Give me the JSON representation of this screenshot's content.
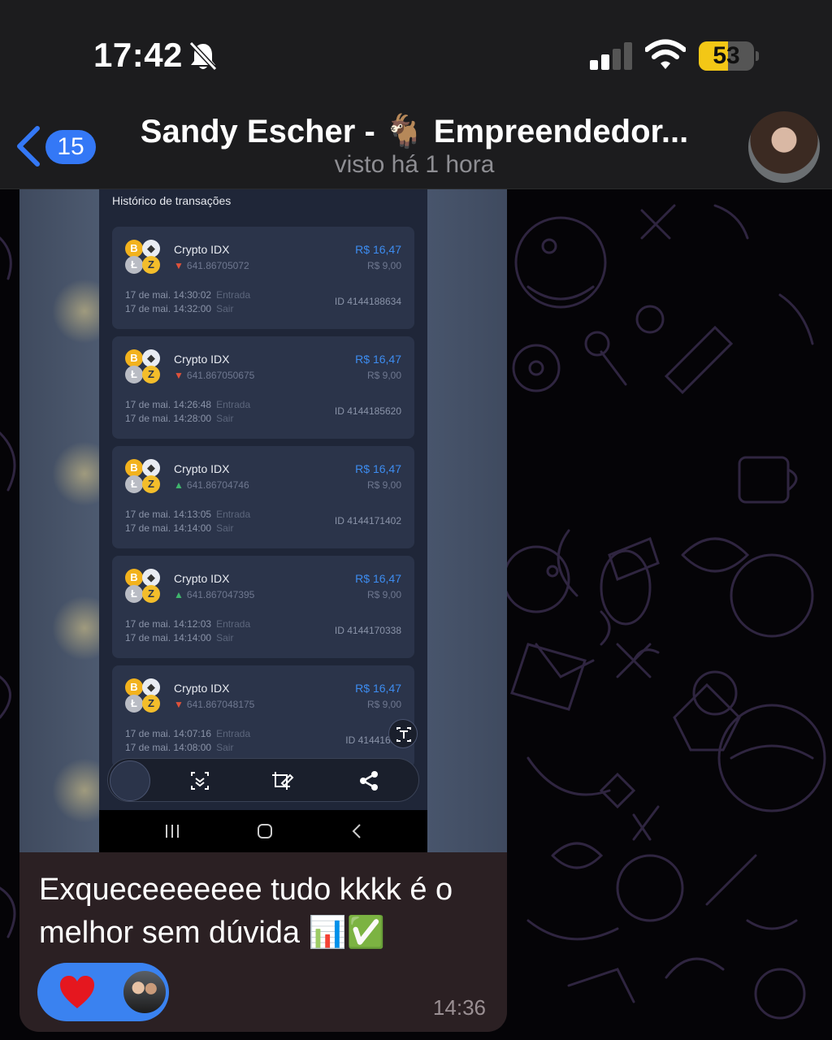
{
  "status_bar": {
    "time": "17:42",
    "battery_level": "53",
    "battery_fraction": 0.53,
    "icons": [
      "bell-slash-icon",
      "signal-icon",
      "wifi-icon",
      "battery-icon"
    ]
  },
  "header": {
    "unread_count": "15",
    "title": "Sandy Escher - 🐐 Empreendedor...",
    "subtitle": "visto há 1 hora"
  },
  "screenshot": {
    "title": "Histórico de transações",
    "transactions": [
      {
        "name": "Crypto IDX",
        "direction": "down",
        "price": "641.86705072",
        "amount": "R$ 16,47",
        "stake": "R$ 9,00",
        "open_date": "17 de mai.",
        "open_time": "14:30:02",
        "open_label": "Entrada",
        "close_date": "17 de mai.",
        "close_time": "14:32:00",
        "close_label": "Sair",
        "id": "ID 4144188634"
      },
      {
        "name": "Crypto IDX",
        "direction": "down",
        "price": "641.867050675",
        "amount": "R$ 16,47",
        "stake": "R$ 9,00",
        "open_date": "17 de mai.",
        "open_time": "14:26:48",
        "open_label": "Entrada",
        "close_date": "17 de mai.",
        "close_time": "14:28:00",
        "close_label": "Sair",
        "id": "ID 4144185620"
      },
      {
        "name": "Crypto IDX",
        "direction": "up",
        "price": "641.86704746",
        "amount": "R$ 16,47",
        "stake": "R$ 9,00",
        "open_date": "17 de mai.",
        "open_time": "14:13:05",
        "open_label": "Entrada",
        "close_date": "17 de mai.",
        "close_time": "14:14:00",
        "close_label": "Sair",
        "id": "ID 4144171402"
      },
      {
        "name": "Crypto IDX",
        "direction": "up",
        "price": "641.867047395",
        "amount": "R$ 16,47",
        "stake": "R$ 9,00",
        "open_date": "17 de mai.",
        "open_time": "14:12:03",
        "open_label": "Entrada",
        "close_date": "17 de mai.",
        "close_time": "14:14:00",
        "close_label": "Sair",
        "id": "ID 4144170338"
      },
      {
        "name": "Crypto IDX",
        "direction": "down",
        "price": "641.867048175",
        "amount": "R$ 16,47",
        "stake": "R$ 9,00",
        "open_date": "17 de mai.",
        "open_time": "14:07:16",
        "open_label": "Entrada",
        "close_date": "17 de mai.",
        "close_time": "14:08:00",
        "close_label": "Sair",
        "id": "ID 41441655"
      }
    ]
  },
  "message": {
    "text": "Exqueceeeeeee tudo kkkk é o melhor sem dúvida 📊✅",
    "time": "14:36",
    "reaction": "heart"
  },
  "colors": {
    "accent": "#3478f6",
    "bubble": "#2b2023",
    "battery": "#f3c716",
    "profit": "#3d8cf0",
    "down": "#e0523a",
    "up": "#3fb56c"
  }
}
